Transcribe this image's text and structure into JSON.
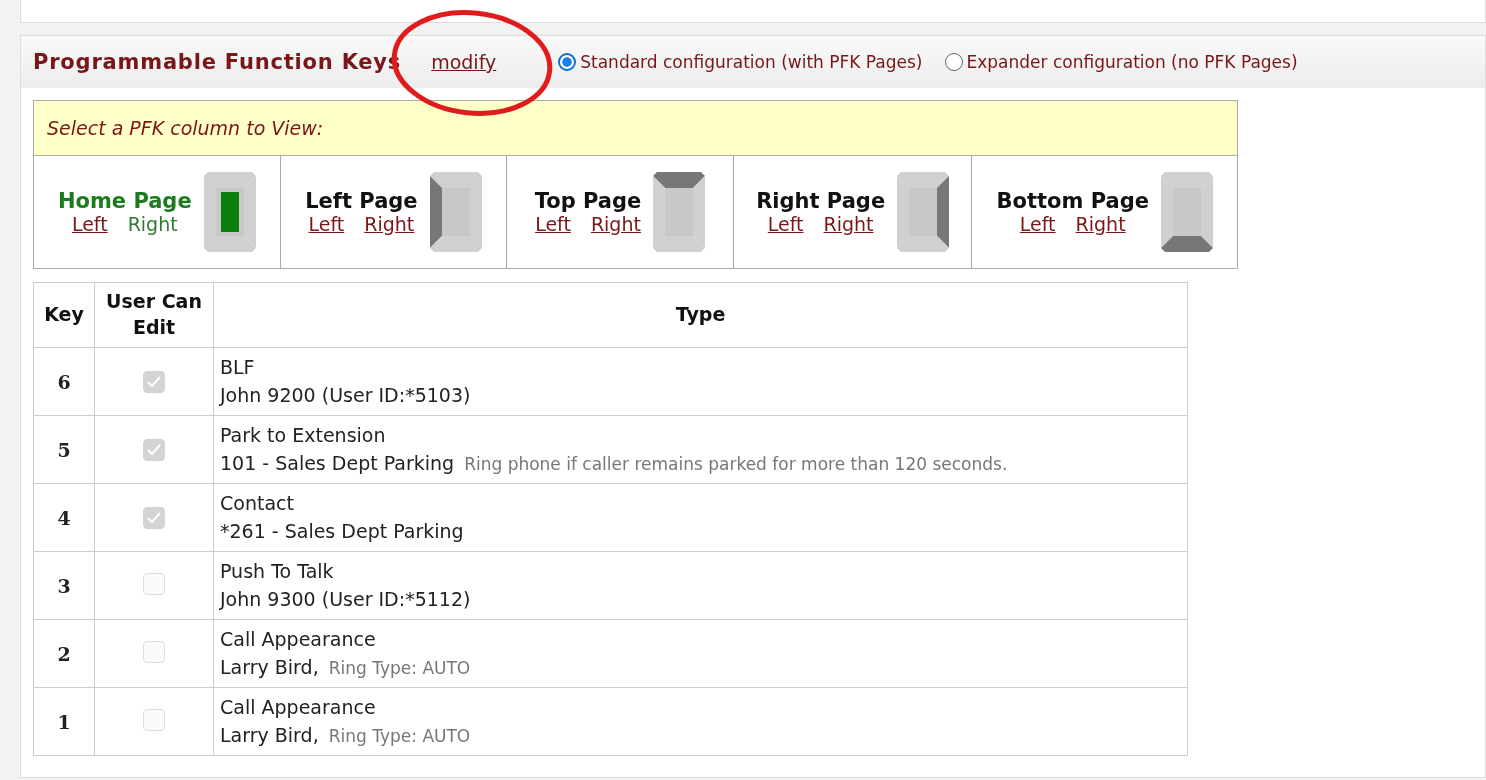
{
  "section": {
    "title": "Programmable Function Keys",
    "modify_link": "modify",
    "annotation_circled": true
  },
  "config_options": [
    {
      "label": "Standard configuration (with PFK Pages)",
      "selected": true
    },
    {
      "label": "Expander configuration (no PFK Pages)",
      "selected": false
    }
  ],
  "pfk_selector": {
    "prompt": "Select a PFK column to View:",
    "pages": [
      {
        "name": "Home Page",
        "selected": true,
        "kind": "center",
        "sides": [
          {
            "label": "Left",
            "selected": false
          },
          {
            "label": "Right",
            "selected": true
          }
        ]
      },
      {
        "name": "Left Page",
        "selected": false,
        "kind": "left",
        "sides": [
          {
            "label": "Left",
            "selected": false
          },
          {
            "label": "Right",
            "selected": false
          }
        ]
      },
      {
        "name": "Top Page",
        "selected": false,
        "kind": "top",
        "sides": [
          {
            "label": "Left",
            "selected": false
          },
          {
            "label": "Right",
            "selected": false
          }
        ]
      },
      {
        "name": "Right Page",
        "selected": false,
        "kind": "right",
        "sides": [
          {
            "label": "Left",
            "selected": false
          },
          {
            "label": "Right",
            "selected": false
          }
        ]
      },
      {
        "name": "Bottom Page",
        "selected": false,
        "kind": "bottom",
        "sides": [
          {
            "label": "Left",
            "selected": false
          },
          {
            "label": "Right",
            "selected": false
          }
        ]
      }
    ]
  },
  "table": {
    "columns": [
      "Key",
      "User Can Edit",
      "Type"
    ],
    "rows": [
      {
        "key": "6",
        "user_can_edit": true,
        "type": "BLF",
        "detail": "John 9200 (User ID:*5103)"
      },
      {
        "key": "5",
        "user_can_edit": true,
        "type": "Park to Extension",
        "detail": "101 - Sales Dept Parking",
        "note": "Ring phone if caller remains parked for more than 120 seconds."
      },
      {
        "key": "4",
        "user_can_edit": true,
        "type": "Contact",
        "detail": "*261 - Sales Dept Parking"
      },
      {
        "key": "3",
        "user_can_edit": false,
        "type": "Push To Talk",
        "detail": "John 9300 (User ID:*5112)"
      },
      {
        "key": "2",
        "user_can_edit": false,
        "type": "Call Appearance",
        "detail": "Larry Bird,",
        "note": "Ring Type: AUTO"
      },
      {
        "key": "1",
        "user_can_edit": false,
        "type": "Call Appearance",
        "detail": "Larry Bird,",
        "note": "Ring Type: AUTO"
      }
    ]
  }
}
